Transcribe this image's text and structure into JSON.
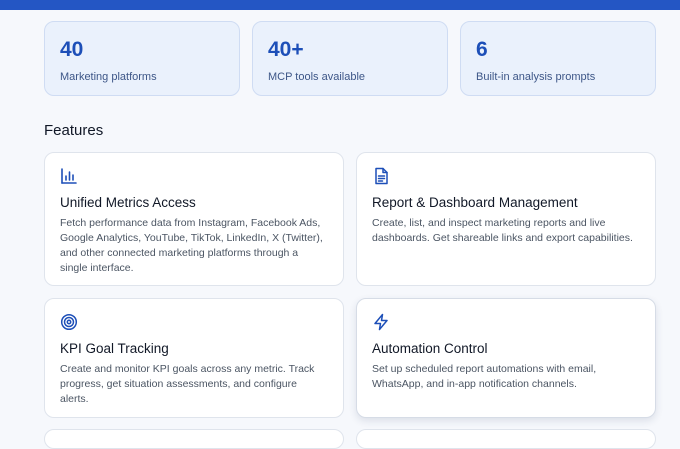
{
  "stats": [
    {
      "value": "40",
      "label": "Marketing platforms"
    },
    {
      "value": "40+",
      "label": "MCP tools available"
    },
    {
      "value": "6",
      "label": "Built-in analysis prompts"
    }
  ],
  "features": {
    "heading": "Features",
    "cards": [
      {
        "icon": "bar-chart-icon",
        "title": "Unified Metrics Access",
        "desc": "Fetch performance data from Instagram, Facebook Ads, Google Analytics, YouTube, TikTok, LinkedIn, X (Twitter), and other connected marketing platforms through a single interface."
      },
      {
        "icon": "document-icon",
        "title": "Report & Dashboard Management",
        "desc": "Create, list, and inspect marketing reports and live dashboards. Get shareable links and export capabilities."
      },
      {
        "icon": "target-icon",
        "title": "KPI Goal Tracking",
        "desc": "Create and monitor KPI goals across any metric. Track progress, get situation assessments, and configure alerts."
      },
      {
        "icon": "lightning-icon",
        "title": "Automation Control",
        "desc": "Set up scheduled report automations with email, WhatsApp, and in-app notification channels."
      }
    ]
  },
  "colors": {
    "accent": "#1d4fb8",
    "topbar": "#2456c4",
    "stat_bg": "#eaf1fc"
  }
}
